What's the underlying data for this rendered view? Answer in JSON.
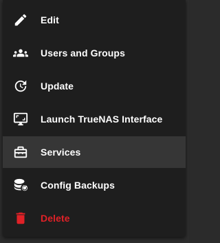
{
  "menu": {
    "items": [
      {
        "label": "Edit",
        "icon": "pencil-icon"
      },
      {
        "label": "Users and Groups",
        "icon": "users-icon"
      },
      {
        "label": "Update",
        "icon": "update-icon"
      },
      {
        "label": "Launch TrueNAS Interface",
        "icon": "monitor-icon"
      },
      {
        "label": "Services",
        "icon": "toolbox-icon",
        "active": true
      },
      {
        "label": "Config Backups",
        "icon": "database-restore-icon"
      },
      {
        "label": "Delete",
        "icon": "trash-icon",
        "color": "#e02127"
      }
    ]
  },
  "colors": {
    "menu_background": "#1e1e1e",
    "active_background": "#363636",
    "text": "#ffffff",
    "danger": "#e02127"
  }
}
